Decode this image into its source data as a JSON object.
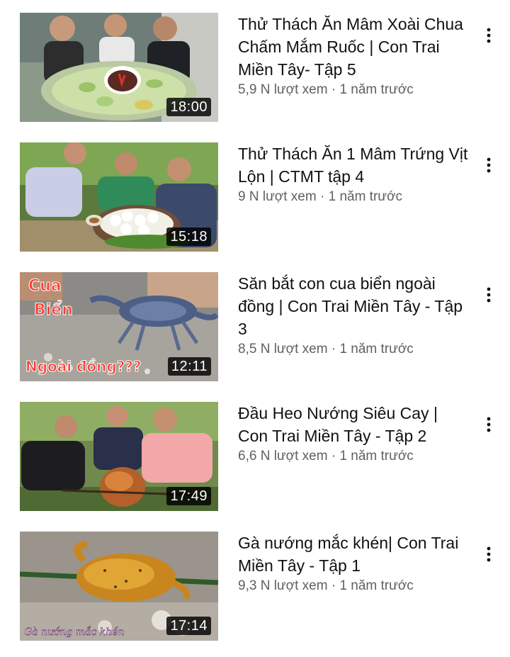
{
  "videos": [
    {
      "title": "Thử Thách Ăn Mâm Xoài Chua Chấm Mắm Ruốc | Con Trai Miền Tây- Tập 5",
      "views": "5,9 N lượt xem",
      "age": "1 năm trước",
      "duration": "18:00"
    },
    {
      "title": "Thử Thách Ăn 1 Mâm Trứng Vịt Lộn | CTMT tập 4",
      "views": "9 N lượt xem",
      "age": "1 năm trước",
      "duration": "15:18"
    },
    {
      "title": "Săn bắt con cua biển ngoài đồng | Con Trai Miền Tây - Tập 3",
      "views": "8,5 N lượt xem",
      "age": "1 năm trước",
      "duration": "12:11",
      "thumb_text": [
        "Cua",
        "Biển",
        "Ngoài đồng???"
      ]
    },
    {
      "title": "Đầu Heo Nướng Siêu Cay | Con Trai Miền Tây  - Tập 2",
      "views": "6,6 N lượt xem",
      "age": "1 năm trước",
      "duration": "17:49"
    },
    {
      "title": "Gà nướng mắc khén| Con Trai Miền Tây - Tập 1",
      "views": "9,3 N lượt xem",
      "age": "1 năm trước",
      "duration": "17:14",
      "thumb_text": [
        "Gà nướng mắc khén"
      ]
    }
  ],
  "separator": "·",
  "icons": {
    "menu": "more-vert-icon"
  },
  "colors": {
    "title": "#111111",
    "subtitle": "#606060",
    "background": "#ffffff"
  }
}
